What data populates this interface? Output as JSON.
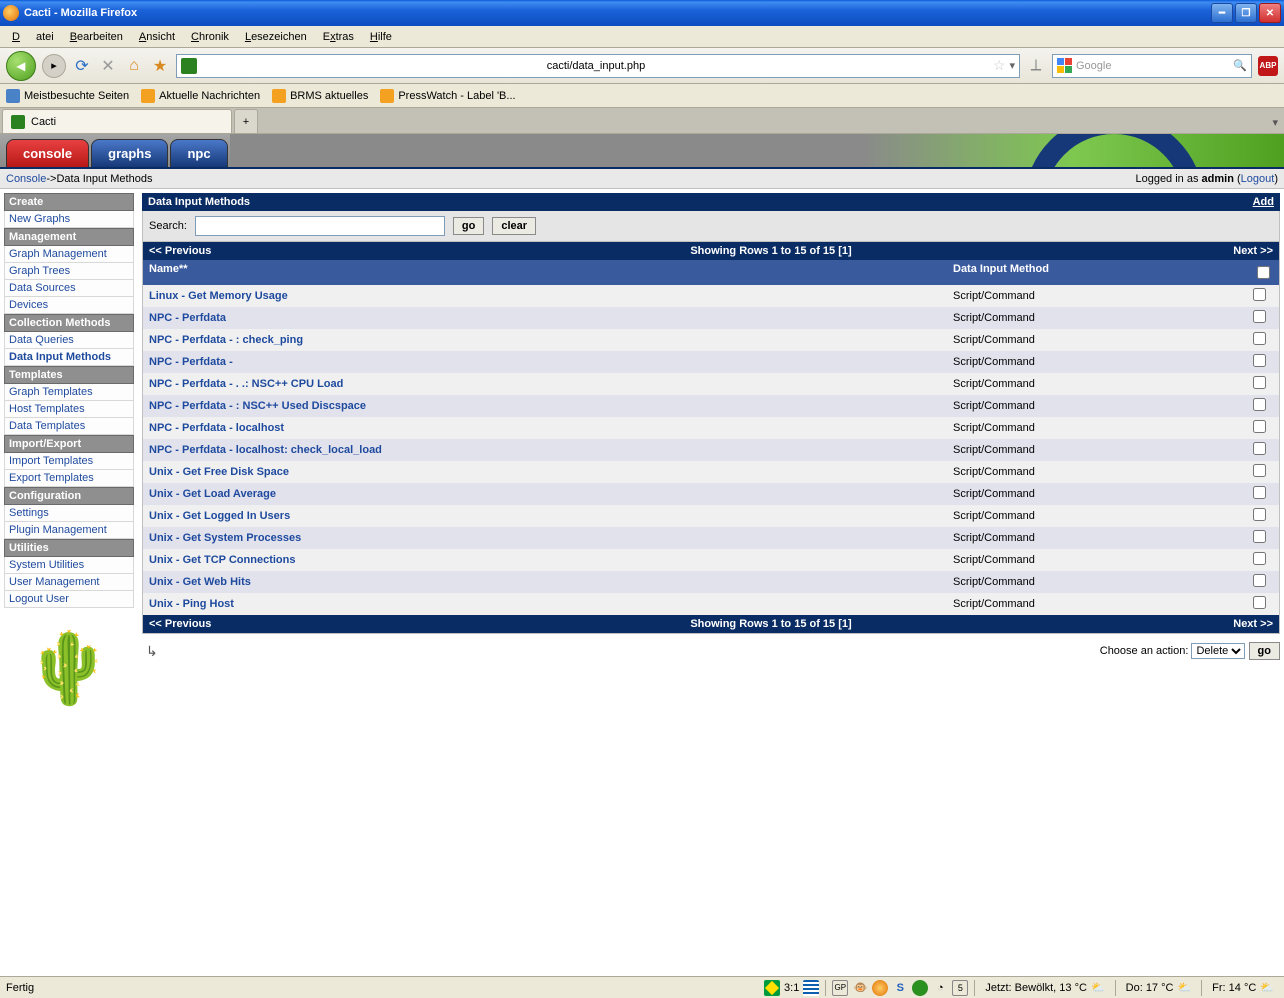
{
  "window": {
    "title": "Cacti - Mozilla Firefox"
  },
  "menu": {
    "file": "Datei",
    "edit": "Bearbeiten",
    "view": "Ansicht",
    "history": "Chronik",
    "bookmarks": "Lesezeichen",
    "extras": "Extras",
    "help": "Hilfe"
  },
  "nav": {
    "url": "cacti/data_input.php",
    "search_placeholder": "Google"
  },
  "bookmarks": {
    "b1": "Meistbesuchte Seiten",
    "b2": "Aktuelle Nachrichten",
    "b3": "BRMS aktuelles",
    "b4": "PressWatch - Label 'B..."
  },
  "tabstrip": {
    "tab1": "Cacti"
  },
  "cacti_tabs": {
    "console": "console",
    "graphs": "graphs",
    "npc": "npc"
  },
  "breadcrumb": {
    "console": "Console",
    "arrow": " -> ",
    "page": "Data Input Methods",
    "login_pre": "Logged in as ",
    "user": "admin",
    "logout": "Logout"
  },
  "sidebar": {
    "create": "Create",
    "new_graphs": "New Graphs",
    "management": "Management",
    "graph_mgmt": "Graph Management",
    "graph_trees": "Graph Trees",
    "data_sources": "Data Sources",
    "devices": "Devices",
    "collection": "Collection Methods",
    "data_queries": "Data Queries",
    "data_input": "Data Input Methods",
    "templates": "Templates",
    "graph_tpl": "Graph Templates",
    "host_tpl": "Host Templates",
    "data_tpl": "Data Templates",
    "import_export": "Import/Export",
    "import_tpl": "Import Templates",
    "export_tpl": "Export Templates",
    "config": "Configuration",
    "settings": "Settings",
    "plugin_mgmt": "Plugin Management",
    "utilities": "Utilities",
    "sys_util": "System Utilities",
    "user_mgmt": "User Management",
    "logout": "Logout User"
  },
  "panel": {
    "title": "Data Input Methods",
    "add": "Add",
    "search_label": "Search:",
    "go": "go",
    "clear": "clear",
    "prev": "<< Previous",
    "showing": "Showing Rows 1 to 15 of 15 [",
    "page_num": "1",
    "showing_end": "]",
    "next": "Next >>",
    "col_name": "Name**",
    "col_method": "Data Input Method"
  },
  "rows": [
    {
      "name": "Linux - Get Memory Usage",
      "method": "Script/Command"
    },
    {
      "name": "NPC - Perfdata",
      "method": "Script/Command"
    },
    {
      "name": "NPC - Perfdata -       : check_ping",
      "method": "Script/Command"
    },
    {
      "name": "NPC - Perfdata - ",
      "method": "Script/Command"
    },
    {
      "name": "NPC - Perfdata -  .   .: NSC++ CPU Load",
      "method": "Script/Command"
    },
    {
      "name": "NPC - Perfdata -      : NSC++ Used Discspace",
      "method": "Script/Command"
    },
    {
      "name": "NPC - Perfdata - localhost",
      "method": "Script/Command"
    },
    {
      "name": "NPC - Perfdata - localhost: check_local_load",
      "method": "Script/Command"
    },
    {
      "name": "Unix - Get Free Disk Space",
      "method": "Script/Command"
    },
    {
      "name": "Unix - Get Load Average",
      "method": "Script/Command"
    },
    {
      "name": "Unix - Get Logged In Users",
      "method": "Script/Command"
    },
    {
      "name": "Unix - Get System Processes",
      "method": "Script/Command"
    },
    {
      "name": "Unix - Get TCP Connections",
      "method": "Script/Command"
    },
    {
      "name": "Unix - Get Web Hits",
      "method": "Script/Command"
    },
    {
      "name": "Unix - Ping Host",
      "method": "Script/Command"
    }
  ],
  "action": {
    "label": "Choose an action:",
    "option": "Delete",
    "go": "go"
  },
  "status": {
    "left": "Fertig",
    "ratio": "3:1",
    "weather_now": "Jetzt: Bewölkt, 13 °C",
    "weather_do": "Do: 17 °C",
    "weather_fr": "Fr: 14 °C"
  }
}
